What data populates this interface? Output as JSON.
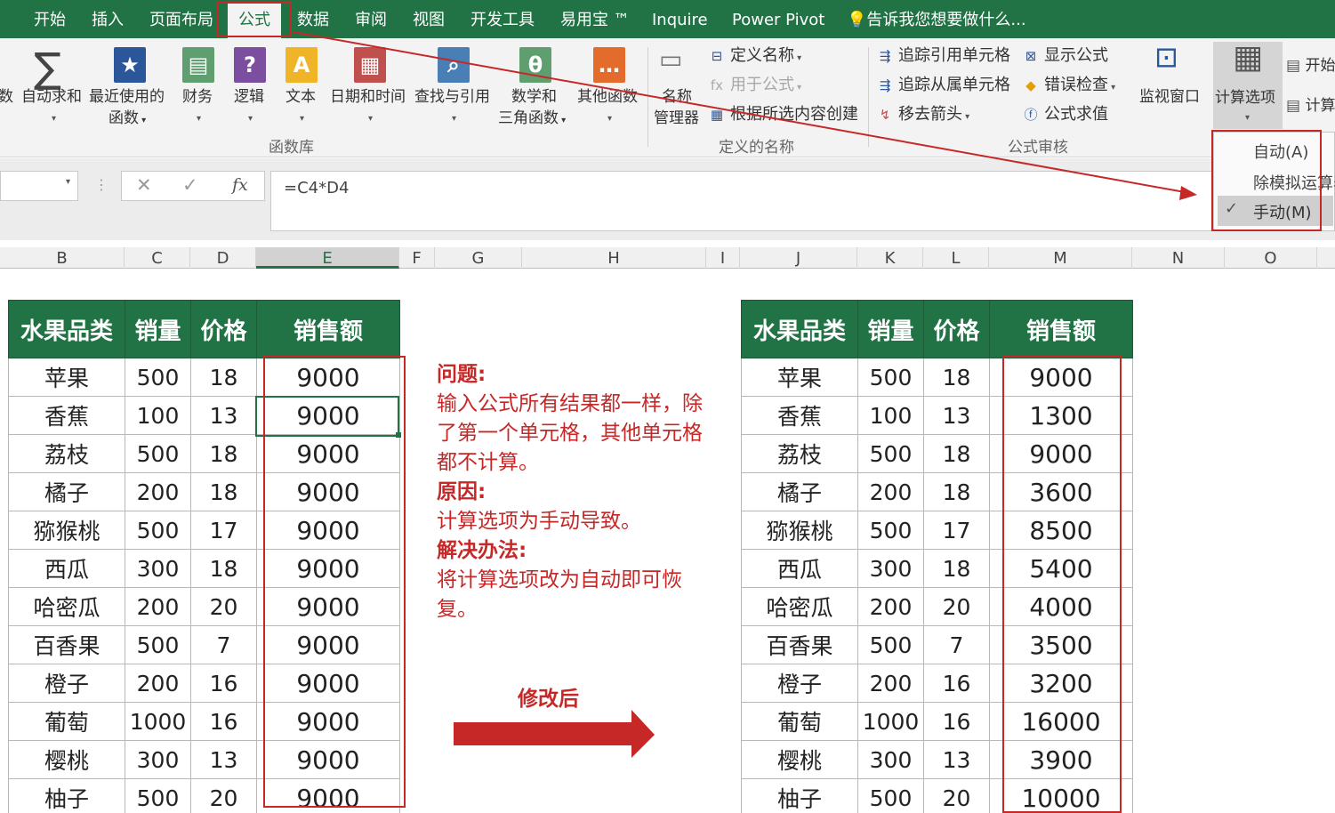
{
  "tabs": [
    {
      "label": "开始"
    },
    {
      "label": "插入"
    },
    {
      "label": "页面布局"
    },
    {
      "label": "公式"
    },
    {
      "label": "数据"
    },
    {
      "label": "审阅"
    },
    {
      "label": "视图"
    },
    {
      "label": "开发工具"
    },
    {
      "label": "易用宝 ™"
    },
    {
      "label": "Inquire"
    },
    {
      "label": "Power Pivot"
    }
  ],
  "tell_me": "告诉我您想要做什么...",
  "ribbon": {
    "function_library": {
      "partial_left": "数",
      "autosum": "自动求和",
      "recent_1": "最近使用的",
      "recent_2": "函数",
      "financial": "财务",
      "logical": "逻辑",
      "text": "文本",
      "datetime": "日期和时间",
      "lookup": "查找与引用",
      "math_1": "数学和",
      "math_2": "三角函数",
      "other": "其他函数",
      "group": "函数库"
    },
    "defined_names": {
      "manager_1": "名称",
      "manager_2": "管理器",
      "define": "定义名称",
      "use_in_formula": "用于公式",
      "create_from_selection": "根据所选内容创建",
      "group": "定义的名称"
    },
    "auditing": {
      "trace_precedents": "追踪引用单元格",
      "trace_dependents": "追踪从属单元格",
      "remove_arrows": "移去箭头",
      "show_formulas": "显示公式",
      "error_checking": "错误检查",
      "evaluate_formula": "公式求值",
      "group": "公式审核"
    },
    "watch_window": "监视窗口",
    "calc_options": "计算选项",
    "calc_now_partial": "开始",
    "calc_sheet_partial": "计算"
  },
  "calc_menu": {
    "auto": "自动(A)",
    "auto_except": "除模拟运算表",
    "manual": "手动(M)",
    "check": "✓"
  },
  "formula_bar": {
    "cancel": "✕",
    "enter": "✓",
    "fx": "fx",
    "formula": "=C4*D4"
  },
  "columns": [
    "B",
    "C",
    "D",
    "E",
    "F",
    "G",
    "H",
    "I",
    "J",
    "K",
    "L",
    "M",
    "N",
    "O"
  ],
  "table_headers": [
    "水果品类",
    "销量",
    "价格",
    "销售额"
  ],
  "before": [
    [
      "苹果",
      "500",
      "18",
      "9000"
    ],
    [
      "香蕉",
      "100",
      "13",
      "9000"
    ],
    [
      "荔枝",
      "500",
      "18",
      "9000"
    ],
    [
      "橘子",
      "200",
      "18",
      "9000"
    ],
    [
      "猕猴桃",
      "500",
      "17",
      "9000"
    ],
    [
      "西瓜",
      "300",
      "18",
      "9000"
    ],
    [
      "哈密瓜",
      "200",
      "20",
      "9000"
    ],
    [
      "百香果",
      "500",
      "7",
      "9000"
    ],
    [
      "橙子",
      "200",
      "16",
      "9000"
    ],
    [
      "葡萄",
      "1000",
      "16",
      "9000"
    ],
    [
      "樱桃",
      "300",
      "13",
      "9000"
    ],
    [
      "柚子",
      "500",
      "20",
      "9000"
    ]
  ],
  "after": [
    [
      "苹果",
      "500",
      "18",
      "9000"
    ],
    [
      "香蕉",
      "100",
      "13",
      "1300"
    ],
    [
      "荔枝",
      "500",
      "18",
      "9000"
    ],
    [
      "橘子",
      "200",
      "18",
      "3600"
    ],
    [
      "猕猴桃",
      "500",
      "17",
      "8500"
    ],
    [
      "西瓜",
      "300",
      "18",
      "5400"
    ],
    [
      "哈密瓜",
      "200",
      "20",
      "4000"
    ],
    [
      "百香果",
      "500",
      "7",
      "3500"
    ],
    [
      "橙子",
      "200",
      "16",
      "3200"
    ],
    [
      "葡萄",
      "1000",
      "16",
      "16000"
    ],
    [
      "樱桃",
      "300",
      "13",
      "3900"
    ],
    [
      "柚子",
      "500",
      "20",
      "10000"
    ]
  ],
  "note": {
    "problem_title": "问题:",
    "problem_text": "输入公式所有结果都一样，除了第一个单元格，其他单元格都不计算。",
    "cause_title": "原因:",
    "cause_text": "计算选项为手动导致。",
    "solution_title": "解决办法:",
    "solution_text": "将计算选项改为自动即可恢复。"
  },
  "after_label": "修改后",
  "colors": {
    "excel_green": "#217346",
    "annotation_red": "#c62828"
  }
}
